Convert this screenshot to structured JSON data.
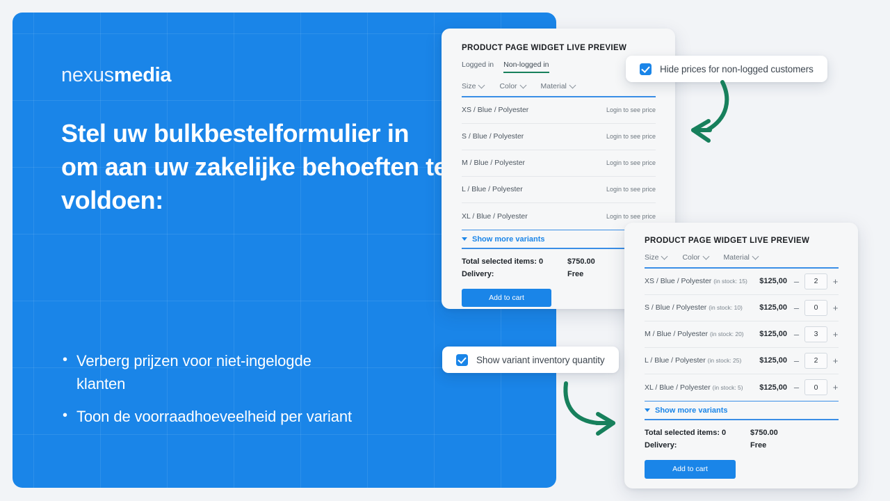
{
  "brand": {
    "light": "nexus",
    "bold": "media"
  },
  "hero": {
    "title": "Stel uw bulkbestelformulier in om aan uw zakelijke behoeften te voldoen:",
    "bullets": [
      "Verberg prijzen voor niet-ingelogde klanten",
      "Toon de voorraadhoeveelheid per variant"
    ],
    "bg_color": "#1a85e8"
  },
  "page": {
    "bg_color": "#f2f4f7"
  },
  "callouts": [
    {
      "label": "Hide prices for non-logged customers",
      "checked": true,
      "icon": "checkbox-checked-icon"
    },
    {
      "label": "Show variant inventory quantity",
      "checked": true,
      "icon": "checkbox-checked-icon"
    }
  ],
  "arrows": {
    "color": "#17805c"
  },
  "widget1": {
    "title": "PRODUCT PAGE WIDGET LIVE PREVIEW",
    "tabs": [
      {
        "label": "Logged in",
        "active": false
      },
      {
        "label": "Non-logged in",
        "active": true
      }
    ],
    "tab_active_color": "#17805c",
    "filters": [
      "Size",
      "Color",
      "Material"
    ],
    "rows": [
      {
        "label": "XS / Blue / Polyester",
        "price": "Login to see price"
      },
      {
        "label": "S / Blue / Polyester",
        "price": "Login to see price"
      },
      {
        "label": "M / Blue / Polyester",
        "price": "Login to see price"
      },
      {
        "label": "L / Blue / Polyester",
        "price": "Login to see price"
      },
      {
        "label": "XL / Blue / Polyester",
        "price": "Login to see price"
      }
    ],
    "show_more": "Show  more variants",
    "totals": [
      {
        "label": "Total selected items: 0",
        "value": "$750.00"
      },
      {
        "label": "Delivery:",
        "value": "Free"
      }
    ],
    "add_to_cart": "Add to cart",
    "accent_color": "#1a85e8"
  },
  "widget2": {
    "title": "PRODUCT PAGE WIDGET LIVE PREVIEW",
    "filters": [
      "Size",
      "Color",
      "Material"
    ],
    "rows": [
      {
        "label": "XS / Blue / Polyester",
        "stock": "(in stock: 15)",
        "price": "$125,00",
        "qty": "2"
      },
      {
        "label": "S / Blue / Polyester",
        "stock": "(in stock: 10)",
        "price": "$125,00",
        "qty": "0"
      },
      {
        "label": "M / Blue / Polyester",
        "stock": "(in stock: 20)",
        "price": "$125,00",
        "qty": "3"
      },
      {
        "label": "L / Blue / Polyester",
        "stock": "(in stock: 25)",
        "price": "$125,00",
        "qty": "2"
      },
      {
        "label": "XL / Blue / Polyester",
        "stock": "(in stock: 5)",
        "price": "$125,00",
        "qty": "0"
      }
    ],
    "minus": "–",
    "plus": "+",
    "show_more": "Show  more variants",
    "totals": [
      {
        "label": "Total selected items: 0",
        "value": "$750.00"
      },
      {
        "label": "Delivery:",
        "value": "Free"
      }
    ],
    "add_to_cart": "Add to cart",
    "accent_color": "#1a85e8"
  }
}
